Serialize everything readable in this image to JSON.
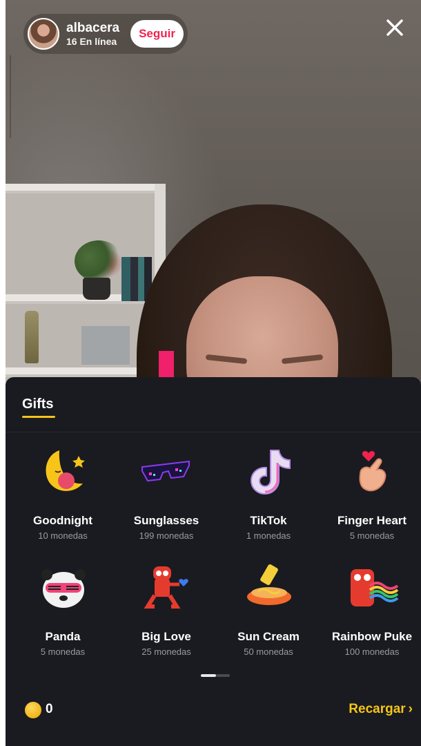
{
  "header": {
    "username": "albacera",
    "viewers": "16 En línea",
    "follow_label": "Seguir",
    "close_icon": "close-icon"
  },
  "panel": {
    "tab_label": "Gifts",
    "gifts": [
      {
        "name": "Goodnight",
        "price": "10 monedas",
        "icon": "moon-icon"
      },
      {
        "name": "Sunglasses",
        "price": "199 monedas",
        "icon": "sunglasses-icon"
      },
      {
        "name": "TikTok",
        "price": "1 monedas",
        "icon": "tiktok-note-icon"
      },
      {
        "name": "Finger Heart",
        "price": "5 monedas",
        "icon": "finger-heart-icon"
      },
      {
        "name": "Panda",
        "price": "5 monedas",
        "icon": "panda-icon"
      },
      {
        "name": "Big Love",
        "price": "25 monedas",
        "icon": "big-love-icon"
      },
      {
        "name": "Sun Cream",
        "price": "50 monedas",
        "icon": "sun-cream-icon"
      },
      {
        "name": "Rainbow Puke",
        "price": "100 monedas",
        "icon": "rainbow-puke-icon"
      }
    ],
    "balance": "0",
    "recharge_label": "Recargar",
    "recharge_chevron": "›"
  },
  "colors": {
    "accent_pink": "#f0206a",
    "follow_red": "#f2224e",
    "gold": "#f5c518",
    "panel_bg": "#1a1b20"
  }
}
